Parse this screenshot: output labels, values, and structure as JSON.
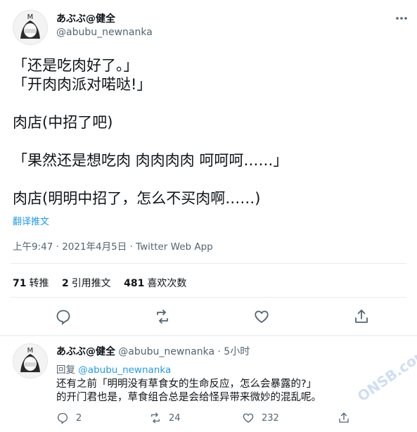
{
  "tweet": {
    "author_name": "あぶぶ@健全",
    "author_handle": "@abubu_newnanka",
    "lines": [
      "「还是吃肉好了。」",
      "「开肉肉派对喏哒!」",
      "",
      "肉店(中招了吧)",
      "",
      "「果然还是想吃肉 肉肉肉肉 呵呵呵……」",
      "",
      "肉店(明明中招了，怎么不买肉啊……)"
    ],
    "translate_label": "翻译推文",
    "meta": "上午9:47 · 2021年4月5日 · Twitter Web App",
    "stats": [
      {
        "count": "71",
        "label": "转推"
      },
      {
        "count": "2",
        "label": "引用推文"
      },
      {
        "count": "481",
        "label": "喜欢次数"
      }
    ]
  },
  "reply": {
    "author_name": "あぶぶ@健全",
    "author_handle": "@abubu_newnanka",
    "time": "· 5小时",
    "reply_prefix": "回复",
    "reply_to": "@abubu_newnanka",
    "lines": [
      "还有之前「明明没有草食女的生命反应，怎么会暴露的?」",
      "的开门君也是，草食组合总是会给怪异带来微妙的混乱呢。"
    ],
    "reply_count": "2",
    "retweet_count": "24",
    "like_count": "232"
  },
  "watermark": "ONSB.com",
  "colors": {
    "accent": "#1d9bf0",
    "text": "#0f1419",
    "secondary": "#536471"
  },
  "icons": {
    "more": "more-horizontal-icon",
    "reply": "comment-icon",
    "retweet": "retweet-icon",
    "like": "heart-icon",
    "share": "share-icon"
  }
}
